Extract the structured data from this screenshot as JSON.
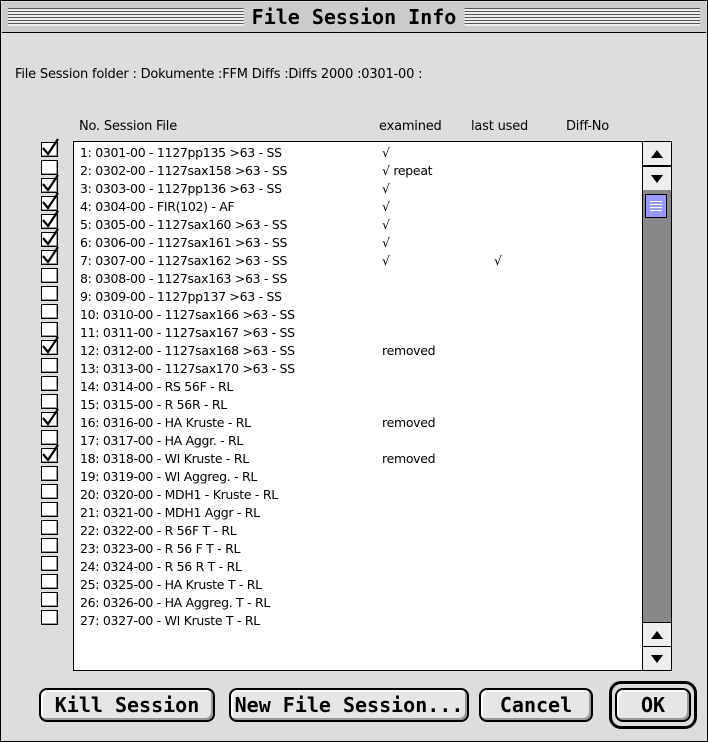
{
  "window": {
    "title": "File Session Info"
  },
  "folder_line": "File Session folder : Dokumente :FFM Diffs :Diffs 2000 :0301-00 :",
  "columns": {
    "no_session_file": "No. Session File",
    "examined": "examined",
    "last_used": "last used",
    "diff_no": "Diff-No"
  },
  "rows": [
    {
      "name": "1: 0301-00 - 1127pp135 >63 - SS",
      "examined": "√",
      "last_used": "",
      "checked": true
    },
    {
      "name": "2: 0302-00 - 1127sax158 >63 - SS",
      "examined": "√ repeat",
      "last_used": "",
      "checked": false
    },
    {
      "name": "3: 0303-00 - 1127pp136 >63 - SS",
      "examined": "√",
      "last_used": "",
      "checked": true
    },
    {
      "name": "4: 0304-00 - FIR(102) - AF",
      "examined": "√",
      "last_used": "",
      "checked": true
    },
    {
      "name": "5: 0305-00 - 1127sax160 >63 - SS",
      "examined": "√",
      "last_used": "",
      "checked": true
    },
    {
      "name": "6: 0306-00 - 1127sax161 >63 - SS",
      "examined": "√",
      "last_used": "",
      "checked": true
    },
    {
      "name": "7: 0307-00 - 1127sax162 >63 - SS",
      "examined": "√",
      "last_used": "√",
      "checked": true
    },
    {
      "name": "8: 0308-00 - 1127sax163 >63 - SS",
      "examined": "",
      "last_used": "",
      "checked": false
    },
    {
      "name": "9: 0309-00 - 1127pp137 >63 - SS",
      "examined": "",
      "last_used": "",
      "checked": false
    },
    {
      "name": "10: 0310-00 - 1127sax166 >63 - SS",
      "examined": "",
      "last_used": "",
      "checked": false
    },
    {
      "name": "11: 0311-00 - 1127sax167 >63 - SS",
      "examined": "",
      "last_used": "",
      "checked": false
    },
    {
      "name": "12: 0312-00 - 1127sax168 >63 - SS",
      "examined": "removed",
      "last_used": "",
      "checked": true
    },
    {
      "name": "13: 0313-00 - 1127sax170 >63 - SS",
      "examined": "",
      "last_used": "",
      "checked": false
    },
    {
      "name": "14: 0314-00 - RS 56F - RL",
      "examined": "",
      "last_used": "",
      "checked": false
    },
    {
      "name": "15: 0315-00 - R 56R - RL",
      "examined": "",
      "last_used": "",
      "checked": false
    },
    {
      "name": "16: 0316-00 - HA Kruste - RL",
      "examined": "removed",
      "last_used": "",
      "checked": true
    },
    {
      "name": "17: 0317-00 - HA Aggr. - RL",
      "examined": "",
      "last_used": "",
      "checked": false
    },
    {
      "name": "18: 0318-00 - WI Kruste - RL",
      "examined": "removed",
      "last_used": "",
      "checked": true
    },
    {
      "name": "19: 0319-00 - WI Aggreg. - RL",
      "examined": "",
      "last_used": "",
      "checked": false
    },
    {
      "name": "20: 0320-00 - MDH1 - Kruste - RL",
      "examined": "",
      "last_used": "",
      "checked": false
    },
    {
      "name": "21: 0321-00 - MDH1 Aggr - RL",
      "examined": "",
      "last_used": "",
      "checked": false
    },
    {
      "name": "22: 0322-00 - R 56F T - RL",
      "examined": "",
      "last_used": "",
      "checked": false
    },
    {
      "name": "23: 0323-00 - R 56 F T - RL",
      "examined": "",
      "last_used": "",
      "checked": false
    },
    {
      "name": "24: 0324-00 - R 56 R T - RL",
      "examined": "",
      "last_used": "",
      "checked": false
    },
    {
      "name": "25: 0325-00 - HA Kruste T - RL",
      "examined": "",
      "last_used": "",
      "checked": false
    },
    {
      "name": "26: 0326-00 - HA Aggreg. T - RL",
      "examined": "",
      "last_used": "",
      "checked": false
    },
    {
      "name": "27: 0327-00 - WI Kruste T - RL",
      "examined": "",
      "last_used": "",
      "checked": false
    }
  ],
  "buttons": {
    "kill": "Kill Session",
    "new": "New File Session...",
    "cancel": "Cancel",
    "ok": "OK"
  },
  "icons": {
    "scroll_up": "arrow-up-icon",
    "scroll_down": "arrow-down-icon",
    "thumb": "scroll-thumb-grip-icon",
    "check": "checkmark-icon"
  },
  "colors": {
    "window_bg": "#dddddd",
    "scrollbar_track": "#888888",
    "scroll_thumb": "#9999ff"
  }
}
